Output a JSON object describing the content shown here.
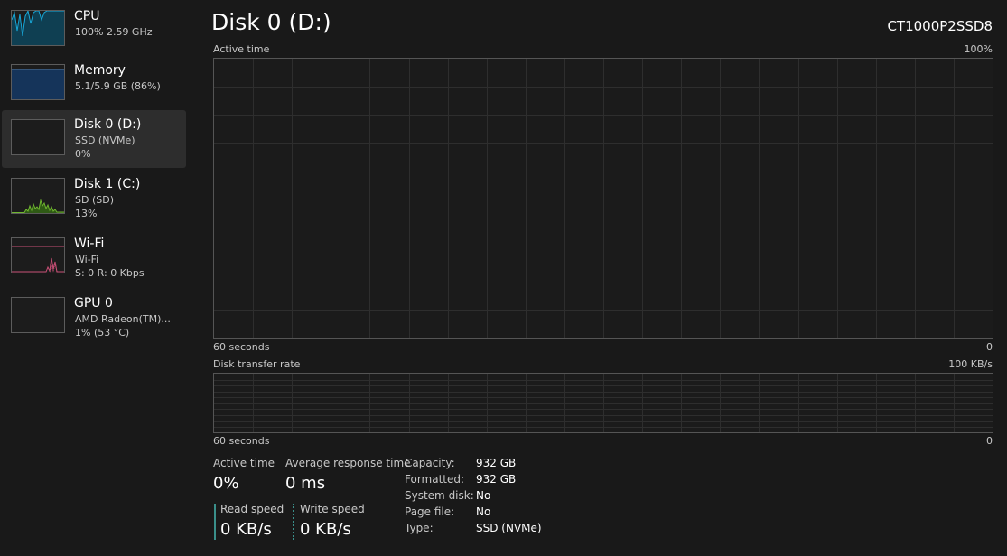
{
  "sidebar": {
    "items": [
      {
        "title": "CPU",
        "lines": [
          "100%  2.59 GHz"
        ],
        "color": "#17a7d8",
        "selected": false
      },
      {
        "title": "Memory",
        "lines": [
          "5.1/5.9 GB (86%)"
        ],
        "color": "#4f8fd8",
        "selected": false
      },
      {
        "title": "Disk 0 (D:)",
        "lines": [
          "SSD (NVMe)",
          "0%"
        ],
        "color": "#6fb62f",
        "selected": true
      },
      {
        "title": "Disk 1 (C:)",
        "lines": [
          "SD (SD)",
          "13%"
        ],
        "color": "#6fb62f",
        "selected": false
      },
      {
        "title": "Wi-Fi",
        "lines": [
          "Wi-Fi",
          "S: 0  R: 0 Kbps"
        ],
        "color": "#c94f76",
        "selected": false
      },
      {
        "title": "GPU 0",
        "lines": [
          "AMD Radeon(TM)...",
          "1%  (53 °C)"
        ],
        "color": "#8a55c4",
        "selected": false
      }
    ]
  },
  "main": {
    "title": "Disk 0 (D:)",
    "model": "CT1000P2SSD8",
    "active_graph": {
      "label": "Active time",
      "max_label": "100%",
      "time_label": "60 seconds",
      "min_label": "0"
    },
    "transfer_graph": {
      "label": "Disk transfer rate",
      "max_label": "100 KB/s",
      "time_label": "60 seconds",
      "min_label": "0"
    },
    "stats": {
      "active_time_label": "Active time",
      "active_time_value": "0%",
      "avg_response_label": "Average response time",
      "avg_response_value": "0 ms",
      "read_speed_label": "Read speed",
      "read_speed_value": "0 KB/s",
      "write_speed_label": "Write speed",
      "write_speed_value": "0 KB/s"
    },
    "properties": [
      {
        "label": "Capacity:",
        "value": "932 GB"
      },
      {
        "label": "Formatted:",
        "value": "932 GB"
      },
      {
        "label": "System disk:",
        "value": "No"
      },
      {
        "label": "Page file:",
        "value": "No"
      },
      {
        "label": "Type:",
        "value": "SSD (NVMe)"
      }
    ],
    "accent_color": "#3a8f8a"
  }
}
